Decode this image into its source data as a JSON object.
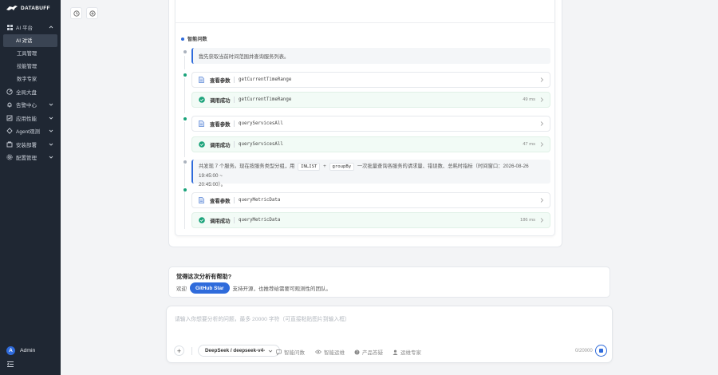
{
  "brand": {
    "name": "DATABUFF"
  },
  "sidebar": {
    "items": [
      {
        "label": "AI 平台",
        "icon": "grid-icon",
        "expanded": true,
        "children": [
          {
            "label": "AI 对话",
            "active": true
          },
          {
            "label": "工具管理"
          },
          {
            "label": "技能管理"
          },
          {
            "label": "数字专家"
          }
        ]
      },
      {
        "label": "全局大盘",
        "icon": "dashboard-icon"
      },
      {
        "label": "告警中心",
        "icon": "bell-icon"
      },
      {
        "label": "应用性能",
        "icon": "chart-icon"
      },
      {
        "label": "Agent观测",
        "icon": "agent-icon"
      },
      {
        "label": "安装部署",
        "icon": "install-icon"
      },
      {
        "label": "配置管理",
        "icon": "settings-icon"
      }
    ],
    "user": {
      "name": "Admin",
      "initial": "A"
    }
  },
  "chat": {
    "section_title": "智能问数",
    "intro": "我先获取当前时间范围并查询服务列表。",
    "calls_1": [
      {
        "label": "查看参数",
        "fn": "getCurrentTimeRange"
      },
      {
        "label": "调用成功",
        "fn": "getCurrentTimeRange",
        "ms": "49 ms"
      },
      {
        "label": "查看参数",
        "fn": "queryServicesAll"
      },
      {
        "label": "调用成功",
        "fn": "queryServicesAll",
        "ms": "47 ms"
      }
    ],
    "summary": {
      "part1": "共发现 7 个服务。现在按服务类型分组，用",
      "code1": "INLIST",
      "plus": "+",
      "code2": "groupBy",
      "part2": "一次批量查询各服务的请求量、错误数、总耗时指标（时间窗口：2026-08-26 19:45:00 ~",
      "part3": "20:45:00）。"
    },
    "calls_2": [
      {
        "label": "查看参数",
        "fn": "queryMetricData"
      },
      {
        "label": "调用成功",
        "fn": "queryMetricData",
        "ms": "186 ms"
      }
    ]
  },
  "feedback": {
    "title": "觉得这次分析有帮助?",
    "prefix": "欢迎",
    "button": "GitHub Star",
    "suffix": "支持开源，也推荐给需要可观测性的团队。"
  },
  "composer": {
    "placeholder": "请输入你想要分析的问题，最多 20000 字符（可直接粘贴图片到输入框）",
    "model": "DeepSeek / deepseek-v4-",
    "tabs": [
      {
        "label": "智能问数",
        "icon": "chat-icon"
      },
      {
        "label": "智能运维",
        "icon": "eye-icon"
      },
      {
        "label": "产品答疑",
        "icon": "help-icon"
      },
      {
        "label": "运维专家",
        "icon": "user-icon"
      }
    ],
    "counter": "0/20000"
  }
}
